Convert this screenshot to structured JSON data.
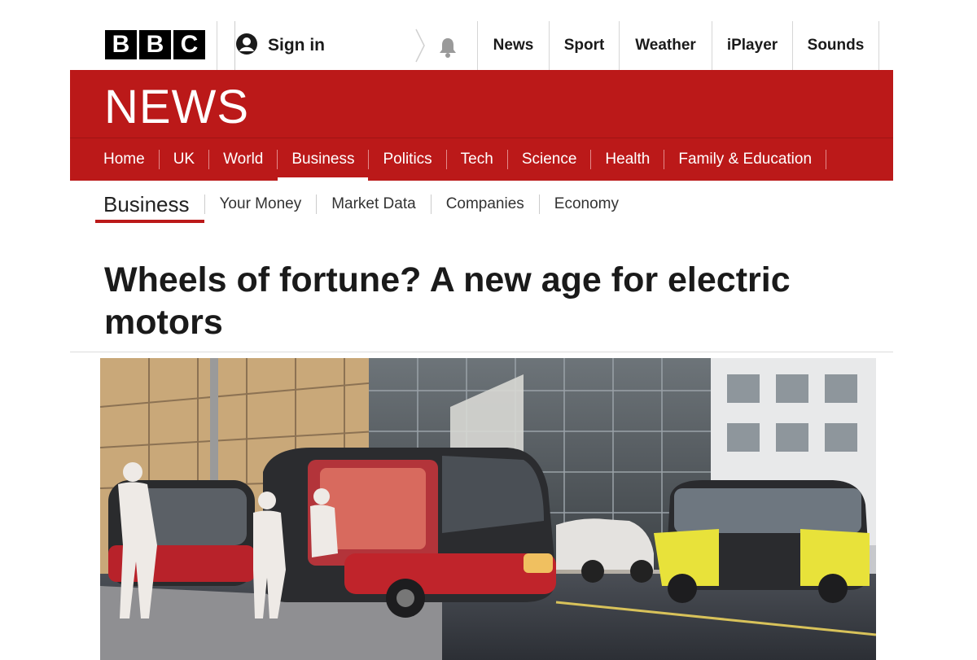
{
  "brand": {
    "letters": [
      "B",
      "B",
      "C"
    ],
    "banner": "NEWS",
    "accent": "#bb1919"
  },
  "account": {
    "signin_label": "Sign in"
  },
  "top_nav": [
    "News",
    "Sport",
    "Weather",
    "iPlayer",
    "Sounds"
  ],
  "main_nav": {
    "items": [
      "Home",
      "UK",
      "World",
      "Business",
      "Politics",
      "Tech",
      "Science",
      "Health",
      "Family & Education"
    ],
    "active": "Business"
  },
  "section_nav": {
    "title": "Business",
    "items": [
      "Your Money",
      "Market Data",
      "Companies",
      "Economy"
    ]
  },
  "article": {
    "headline": "Wheels of fortune? A new age for electric motors"
  },
  "icons": {
    "user": "user-icon",
    "bell": "bell-icon"
  }
}
